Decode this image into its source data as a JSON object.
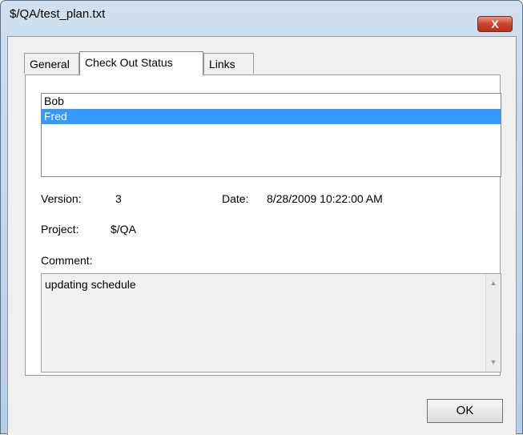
{
  "window": {
    "title": "$/QA/test_plan.txt",
    "close_glyph": "X"
  },
  "tabs": [
    {
      "label": "General",
      "active": false
    },
    {
      "label": "Check Out Status",
      "active": true
    },
    {
      "label": "Links",
      "active": false
    }
  ],
  "checkout_list": {
    "items": [
      {
        "label": "Bob",
        "selected": false
      },
      {
        "label": "Fred",
        "selected": true
      }
    ]
  },
  "details": {
    "version_label": "Version:",
    "version_value": "3",
    "date_label": "Date:",
    "date_value": "8/28/2009 10:22:00 AM",
    "project_label": "Project:",
    "project_value": "$/QA",
    "comment_label": "Comment:",
    "comment_value": "updating schedule"
  },
  "buttons": {
    "ok": "OK"
  },
  "colors": {
    "selection": "#3399ff",
    "close_button": "#c9442c"
  }
}
